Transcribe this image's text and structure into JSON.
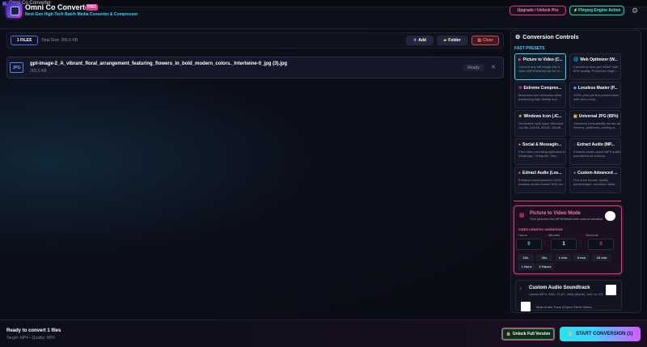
{
  "window": {
    "title": "Omni Co Converter"
  },
  "header": {
    "app_name": "Omni Co Converter",
    "badge": "PRO",
    "subtitle": "Next-Gen High-Tech Batch Media Converter & Compressor",
    "upgrade_label": "Upgrade / Unlock Pro",
    "ffmpeg_label": "Ffmpeg Engine Active"
  },
  "toolbar": {
    "files_count": "1 FILES",
    "total_size": "Total Size: 265.5 KB",
    "add_label": "Add",
    "folder_label": "Folder",
    "clear_label": "Clear"
  },
  "files": [
    {
      "ext": "JPG",
      "name": "gpt-image-2_A_vibrant_floral_arrangement_featuring_flowers_in_bold_modern_colors._Intertwine-0_jpg (3).jpg",
      "size": "265.5 KB",
      "status": "Ready"
    }
  ],
  "controls": {
    "title": "Conversion Controls",
    "fast_presets_label": "FAST PRESETS",
    "presets": [
      {
        "icon": "▶",
        "title": "Picture to Video (C...",
        "desc": "Convert any still image into a video (MP4/WebM) set for ex...",
        "active": true
      },
      {
        "icon": "🌐",
        "title": "Web Optimizer (W...",
        "desc": "Convert to next-gen WebP with 80% quality. Preserves origin..."
      },
      {
        "icon": "⚙",
        "title": "Extreme Compres...",
        "desc": "Maximum size reduction while preserving high-fidelity and ..."
      },
      {
        "icon": "◆",
        "title": "Lossless Master (P...",
        "desc": "100% pixel-perfect preservation with zero-comp..."
      },
      {
        "icon": "★",
        "title": "Windows Icon (.IC...",
        "desc": "Generates multi-layer Windows .ico file (16x16, 32x32, 48x48, ..."
      },
      {
        "icon": "▣",
        "title": "Universal JPG (85%)",
        "desc": "Universal compatibility across all devices, platforms, printing a..."
      },
      {
        "icon": "●",
        "title": "Social & Messagin...",
        "desc": "Fast video encoding optimized for WhatsApp, Telegram, Disc..."
      },
      {
        "icon": "♪",
        "title": "Extract Audio (MP...",
        "desc": "Extracts studio-grade MP3 audio soundtrack at maximu..."
      },
      {
        "icon": "●",
        "title": "Extract Audio (Los...",
        "desc": "Extracts uncompressed 100% lossless studio master WAV au..."
      },
      {
        "icon": "●",
        "title": "Custom Advanced ...",
        "desc": "Fine-tune format, quality percentages, resolution dime..."
      }
    ],
    "pvm": {
      "title": "Picture to Video Mode",
      "desc": "Turn pictures into MP4/WebM with custom duration",
      "length_label": "VIDEO LENGTH / DURATION:",
      "hours_label": "Hours",
      "minutes_label": "Minutes",
      "seconds_label": "Seconds",
      "hours": "0",
      "minutes": "1",
      "seconds": "0",
      "chips_row1": [
        "10s",
        "30s",
        "1 min",
        "5 min",
        "15 min"
      ],
      "chips_row2": [
        "1 Hour",
        "2 Hours"
      ]
    },
    "audio": {
      "title": "Custom Audio Soundtrack",
      "desc": "Upload MP3, WAV, FLAC, M4A (Apple), AAC or OGG",
      "mute_label": "Mute Audio Track (Export Silent Video)"
    }
  },
  "footer": {
    "status": "Ready to convert 1 files",
    "target": "Target: MP4 • Quality: 80%",
    "unlock_label": "Unlock Full Version",
    "start_label": "START CONVERSION (1)"
  },
  "colors": {
    "accent_cyan": "#3fd3ff",
    "accent_pink": "#e8358f",
    "background": "#0b0d16"
  }
}
